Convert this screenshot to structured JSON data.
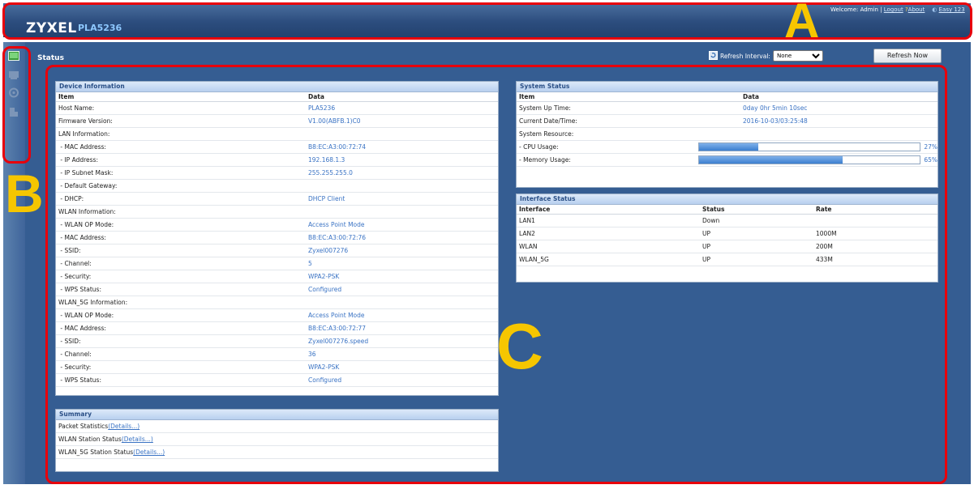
{
  "header": {
    "brand": "ZYXEL",
    "model": "PLA5236",
    "welcome": "Welcome: Admin |",
    "logout": "Logout",
    "about": "About",
    "easy": "Easy 123"
  },
  "sidebar": {
    "icons": [
      "dashboard-icon",
      "monitor-icon",
      "network-icon",
      "maintenance-icon"
    ]
  },
  "main": {
    "title": "Status",
    "refresh_label": "Refresh Interval:",
    "refresh_value": "None",
    "refresh_options": [
      "None"
    ],
    "refresh_now": "Refresh Now"
  },
  "device_info": {
    "title": "Device Information",
    "col_item": "Item",
    "col_data": "Data",
    "rows": [
      {
        "item": "Host Name:",
        "data": "PLA5236"
      },
      {
        "item": "Firmware Version:",
        "data": "V1.00(ABFB.1)C0"
      },
      {
        "item": "LAN Information:",
        "data": ""
      },
      {
        "item": " - MAC Address:",
        "data": "B8:EC:A3:00:72:74"
      },
      {
        "item": " - IP Address:",
        "data": "192.168.1.3"
      },
      {
        "item": " - IP Subnet Mask:",
        "data": "255.255.255.0"
      },
      {
        "item": " - Default Gateway:",
        "data": ""
      },
      {
        "item": " - DHCP:",
        "data": "DHCP Client"
      },
      {
        "item": "WLAN Information:",
        "data": ""
      },
      {
        "item": " - WLAN OP Mode:",
        "data": "Access Point Mode"
      },
      {
        "item": " - MAC Address:",
        "data": "B8:EC:A3:00:72:76"
      },
      {
        "item": " - SSID:",
        "data": "Zyxel007276"
      },
      {
        "item": " - Channel:",
        "data": "5"
      },
      {
        "item": " - Security:",
        "data": "WPA2-PSK"
      },
      {
        "item": " - WPS Status:",
        "data": "Configured"
      },
      {
        "item": "WLAN_5G Information:",
        "data": ""
      },
      {
        "item": " - WLAN OP Mode:",
        "data": "Access Point Mode"
      },
      {
        "item": " - MAC Address:",
        "data": "B8:EC:A3:00:72:77"
      },
      {
        "item": " - SSID:",
        "data": "Zyxel007276.speed"
      },
      {
        "item": " - Channel:",
        "data": "36"
      },
      {
        "item": " - Security:",
        "data": "WPA2-PSK"
      },
      {
        "item": " - WPS Status:",
        "data": "Configured"
      }
    ]
  },
  "summary": {
    "title": "Summary",
    "rows": [
      {
        "label": "Packet Statistics",
        "link": "(Details...)"
      },
      {
        "label": "WLAN Station Status",
        "link": "(Details...)"
      },
      {
        "label": "WLAN_5G Station Status",
        "link": "(Details...)"
      }
    ]
  },
  "system_status": {
    "title": "System Status",
    "col_item": "Item",
    "col_data": "Data",
    "up_time_label": "System Up Time:",
    "up_time": "0day 0hr 5min 10sec",
    "datetime_label": "Current Date/Time:",
    "datetime": "2016-10-03/03:25:48",
    "resource_label": "System Resource:",
    "cpu_label": "- CPU Usage:",
    "cpu_percent": 27,
    "cpu_text": "27%",
    "mem_label": "- Memory Usage:",
    "mem_percent": 65,
    "mem_text": "65%"
  },
  "interface_status": {
    "title": "Interface Status",
    "col_interface": "Interface",
    "col_status": "Status",
    "col_rate": "Rate",
    "rows": [
      {
        "interface": "LAN1",
        "status": "Down",
        "rate": ""
      },
      {
        "interface": "LAN2",
        "status": "UP",
        "rate": "1000M"
      },
      {
        "interface": "WLAN",
        "status": "UP",
        "rate": "200M"
      },
      {
        "interface": "WLAN_5G",
        "status": "UP",
        "rate": "433M"
      }
    ]
  },
  "annotations": {
    "a": "A",
    "b": "B",
    "c": "C",
    "color": "#e8000b",
    "letter_color": "#f6c600"
  }
}
